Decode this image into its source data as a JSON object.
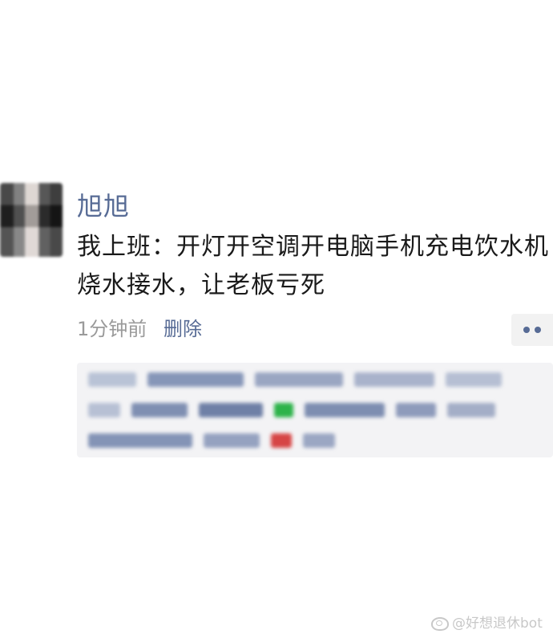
{
  "post": {
    "author": "旭旭",
    "text": "我上班：开灯开空调开电脑手机充电饮水机烧水接水，让老板亏死",
    "time": "1分钟前",
    "delete_label": "删除"
  },
  "likes_section": {
    "blurred": true
  },
  "watermark": {
    "text": "@好想退休bot"
  },
  "colors": {
    "link": "#576b95",
    "meta": "#9a9a9a",
    "likes_bg": "#f3f3f5",
    "more_bg": "#f2f2f2"
  },
  "icons": {
    "more": "ellipsis-icon",
    "watermark": "weibo-icon"
  }
}
